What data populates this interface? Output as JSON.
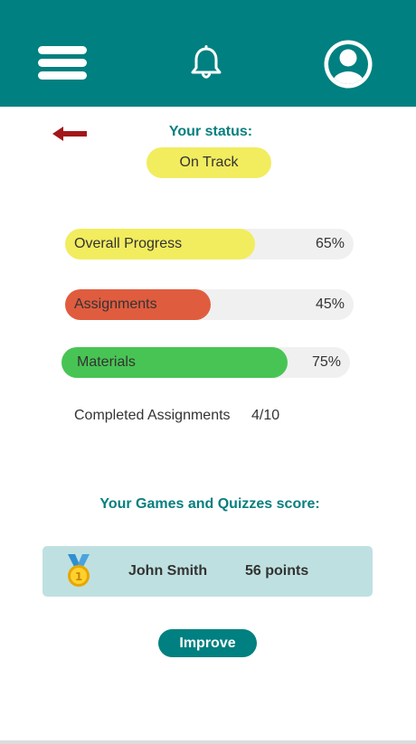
{
  "header": {
    "menu_icon": "hamburger-menu-icon",
    "notification_icon": "bell-icon",
    "profile_icon": "user-avatar-icon",
    "background": "#008080"
  },
  "nav": {
    "back_icon": "back-arrow-icon",
    "back_color": "#a3161a"
  },
  "status": {
    "title": "Your status:",
    "value": "On Track",
    "badge_color": "#f2ec5f"
  },
  "progress_bars": [
    {
      "label": "Overall Progress",
      "percent_text": "65%",
      "value": 65,
      "color": "#f2ec5f"
    },
    {
      "label": "Assignments",
      "percent_text": "45%",
      "value": 45,
      "color": "#e05c3f"
    },
    {
      "label": "Materials",
      "percent_text": "75%",
      "value": 75,
      "color": "#48c454"
    }
  ],
  "completed": {
    "label": "Completed Assignments",
    "value": "4/10"
  },
  "games": {
    "title": "Your Games and Quizzes score:",
    "medal_icon": "gold-medal-icon",
    "player_name": "John Smith",
    "points": "56 points"
  },
  "improve_button": {
    "label": "Improve"
  }
}
